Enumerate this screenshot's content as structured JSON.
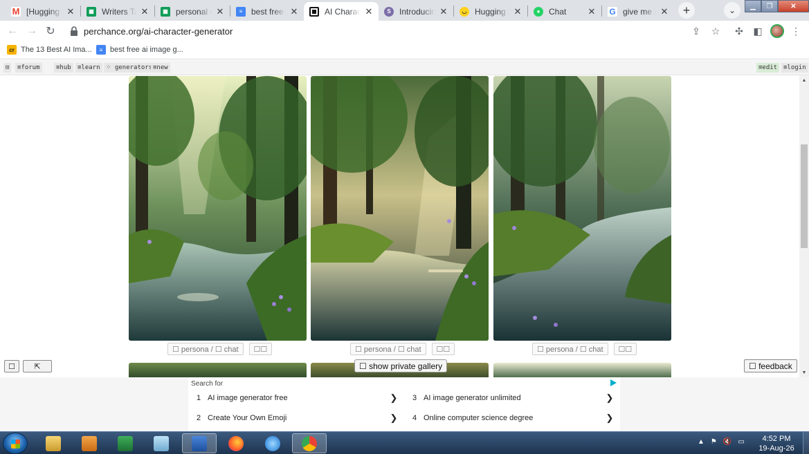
{
  "browser": {
    "tabs": [
      {
        "title": "[Hugging Fa",
        "icon": "gmail-icon"
      },
      {
        "title": "Writers Tas",
        "icon": "sheets-icon"
      },
      {
        "title": "personal e",
        "icon": "sheets-icon"
      },
      {
        "title": "best free ai",
        "icon": "docs-icon"
      },
      {
        "title": "AI Characte",
        "icon": "perchance-icon",
        "active": true
      },
      {
        "title": "Introducing",
        "icon": "s-icon"
      },
      {
        "title": "Hugging Fa",
        "icon": "hugging-face-icon"
      },
      {
        "title": "Chat",
        "icon": "chat-icon"
      },
      {
        "title": "give me a g",
        "icon": "google-icon"
      }
    ],
    "url": "perchance.org/ai-character-generator",
    "bookmarks": [
      {
        "label": "The 13 Best AI Ima...",
        "icon": "cr-icon"
      },
      {
        "label": "best free ai image g...",
        "icon": "docs-icon"
      }
    ]
  },
  "site_nav": {
    "left": [
      "⊡",
      "≡forum",
      "≡hub",
      "≡learn",
      "⁘ generators",
      "≡new"
    ],
    "right": [
      "≡edit",
      "≡login"
    ]
  },
  "gallery": {
    "cards": [
      {
        "persona_label": "☐ persona / ☐ chat",
        "extra_label": "☐☐"
      },
      {
        "persona_label": "☐ persona / ☐ chat",
        "extra_label": "☐☐"
      },
      {
        "persona_label": "☐ persona / ☐ chat",
        "extra_label": "☐☐"
      }
    ],
    "show_private_label": "☐ show private gallery",
    "feedback_label": "☐ feedback",
    "left_btn1": "☐",
    "left_btn2": "⇱"
  },
  "ad": {
    "label": "Search for",
    "items": [
      {
        "num": "1",
        "text": "AI image generator free"
      },
      {
        "num": "3",
        "text": "AI image generator unlimited"
      },
      {
        "num": "2",
        "text": "Create Your Own Emoji"
      },
      {
        "num": "4",
        "text": "Online computer science degree"
      }
    ]
  },
  "taskbar": {
    "time": "4:52 PM",
    "date": "19-Aug-26",
    "apps": [
      "explorer-icon",
      "media-player-icon",
      "excel-icon",
      "notepad-icon",
      "word-icon",
      "firefox-icon",
      "ie-icon",
      "chrome-icon"
    ]
  }
}
